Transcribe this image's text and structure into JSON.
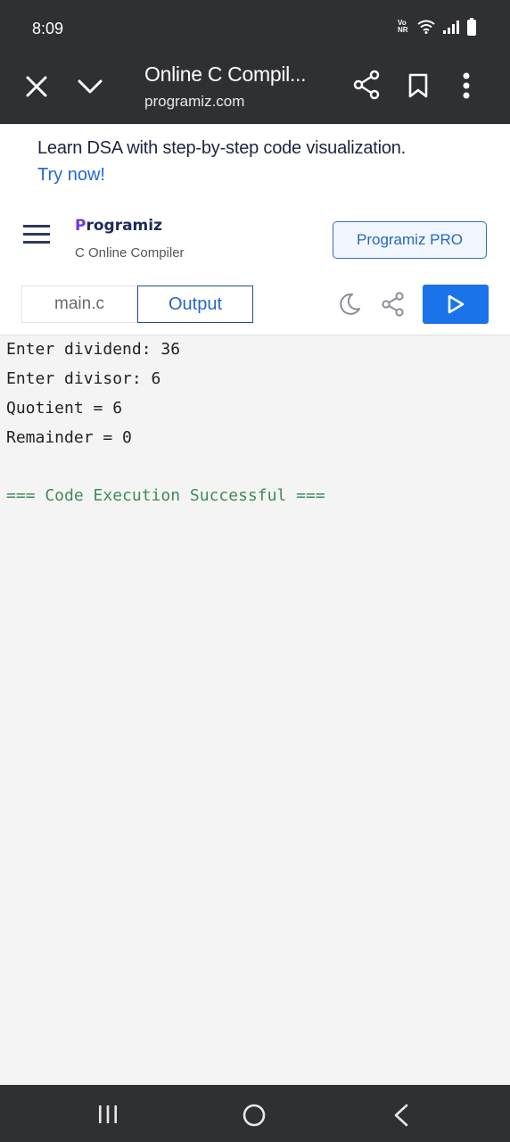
{
  "status_bar": {
    "time": "8:09",
    "volte_label": "Vo NR"
  },
  "browser": {
    "title": "Online C Compil...",
    "url": "programiz.com"
  },
  "banner": {
    "message": "Learn DSA with step-by-step code visualization.",
    "cta": "Try now!"
  },
  "site_header": {
    "logo_initial": "P",
    "logo_rest": "rogramiz",
    "subtitle": "C Online Compiler",
    "pro_button": "Programiz PRO"
  },
  "toolbar": {
    "tab_main": "main.c",
    "tab_output": "Output"
  },
  "output": {
    "lines": [
      "Enter dividend: 36",
      "Enter divisor: 6",
      "Quotient = 6",
      "Remainder = 0"
    ],
    "success": "=== Code Execution Successful ==="
  },
  "icons": [
    "wifi-icon",
    "signal-icon",
    "battery-icon",
    "close-icon",
    "chevron-down-icon",
    "share-icon",
    "bookmark-icon",
    "more-vert-icon",
    "hamburger-icon",
    "moon-icon",
    "share-icon",
    "play-icon",
    "recents-icon",
    "home-icon",
    "back-icon"
  ],
  "colors": {
    "accent": "#1a73e8",
    "success": "#3f8c58",
    "dark_bar": "#2f3033"
  }
}
